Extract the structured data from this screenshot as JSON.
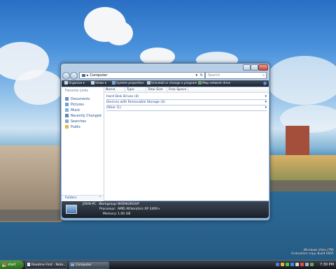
{
  "window": {
    "address": "Computer",
    "search_placeholder": "Search",
    "toolbar": {
      "organize": "Organize",
      "views": "Views",
      "system_properties": "System properties",
      "uninstall": "Uninstall or change a program",
      "map_drive": "Map network drive",
      "help": "?"
    },
    "nav": {
      "header": "Favorite Links",
      "items": [
        {
          "label": "Documents",
          "icon": "documents-folder-icon",
          "color": "#6b8fc4"
        },
        {
          "label": "Pictures",
          "icon": "pictures-folder-icon",
          "color": "#6aa0d8"
        },
        {
          "label": "Music",
          "icon": "music-folder-icon",
          "color": "#7fb0e0"
        },
        {
          "label": "Recently Changed",
          "icon": "recent-folder-icon",
          "color": "#5a86c0"
        },
        {
          "label": "Searches",
          "icon": "searches-icon",
          "color": "#8aa8cc"
        },
        {
          "label": "Public",
          "icon": "public-folder-icon",
          "color": "#e0b84a"
        }
      ],
      "folders": "Folders",
      "folders_arrow": "^"
    },
    "columns": [
      "Name",
      "Type",
      "Total Size",
      "Free Space"
    ],
    "groups": [
      {
        "label": "Hard Disk Drives (4)"
      },
      {
        "label": "Devices with Removable Storage (4)"
      },
      {
        "label": "Other (1)"
      }
    ],
    "details": {
      "computer": "JOHN-PC",
      "workgroup_label": "Workgroup:",
      "workgroup": "WORKGROUP",
      "processor_label": "Processor:",
      "processor": "AMD Athlon(tm) XP 2400+",
      "memory_label": "Memory:",
      "memory": "1.00 GB"
    }
  },
  "taskbar": {
    "start": "start",
    "tasks": [
      {
        "label": "Readme First - Note..."
      },
      {
        "label": "Computer"
      }
    ],
    "clock": "7:30 PM"
  },
  "watermark": {
    "line1": "Windows Vista (TM)",
    "line2": "Evaluation copy. Build 6001"
  },
  "colors": {
    "accent": "#1e3f8a",
    "toolbar": "#1d2632",
    "link": "#1f4f8c"
  }
}
